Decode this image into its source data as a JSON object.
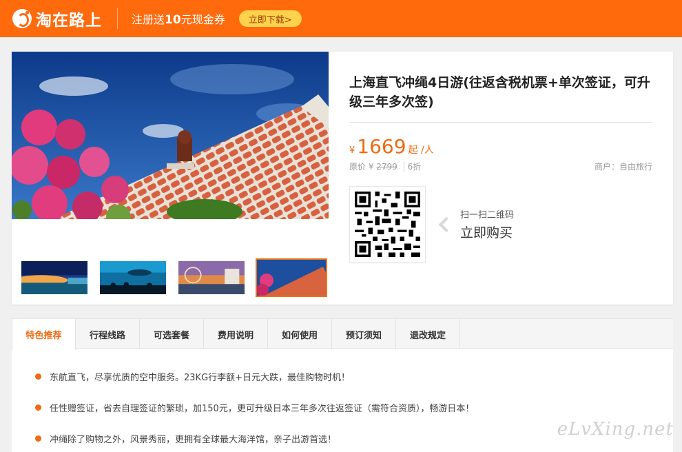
{
  "header": {
    "brand": "淘在路上",
    "promo_prefix": "注册送",
    "promo_amount": "10",
    "promo_suffix": "元现金券",
    "download_label": "立即下载>"
  },
  "product": {
    "title": "上海直飞冲绳4日游(往返含税机票+单次签证，可升级三年多次签)",
    "currency": "¥",
    "price": "1669",
    "price_unit": "起 /人",
    "original_label": "原价 ¥",
    "original_price": "2799",
    "discount": "6折",
    "merchant": "商户：自由旅行",
    "qr_scan_text": "扫一扫二维码",
    "qr_buy_text": "立即购买",
    "thumbnails": [
      "night-coast-thumb",
      "aquarium-thumb",
      "ferris-wheel-thumb",
      "roof-tiles-thumb"
    ],
    "active_thumbnail": 3
  },
  "tabs": [
    "特色推荐",
    "行程线路",
    "可选套餐",
    "费用说明",
    "如何使用",
    "预订须知",
    "退改规定"
  ],
  "active_tab": 0,
  "features": [
    "东航直飞，尽享优质的空中服务。23KG行李额+日元大跌，最佳购物时机！",
    "任性赠签证，省去自理签证的繁琐，加150元，更可升级日本三年多次往返签证（需符合资质），畅游日本！",
    "冲绳除了购物之外，风景秀丽，更拥有全球最大海洋馆，亲子出游首选！"
  ],
  "watermark": "eLvXing.net",
  "colors": {
    "brand": "#ff6a0d",
    "price": "#ef6a12",
    "tab_active": "#ef6a12"
  }
}
